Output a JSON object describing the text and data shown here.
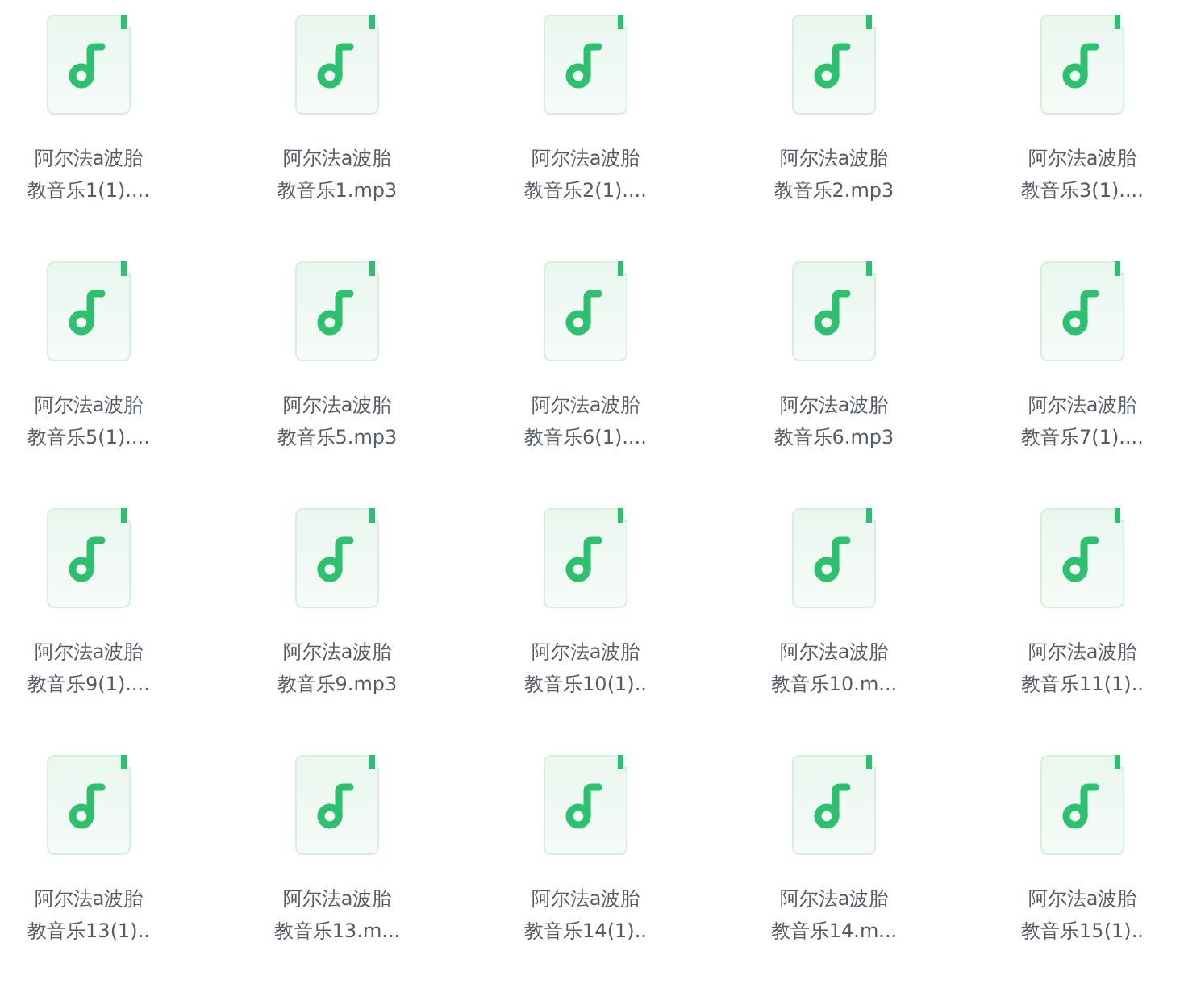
{
  "files": [
    {
      "lines": [
        "阿尔法a波胎",
        "教音乐1(1)...."
      ]
    },
    {
      "lines": [
        "阿尔法a波胎",
        "教音乐1.mp3"
      ]
    },
    {
      "lines": [
        "阿尔法a波胎",
        "教音乐2(1)...."
      ]
    },
    {
      "lines": [
        "阿尔法a波胎",
        "教音乐2.mp3"
      ]
    },
    {
      "lines": [
        "阿尔法a波胎",
        "教音乐3(1)...."
      ]
    },
    {
      "lines": [
        "阿尔法a波胎",
        "教音乐5(1)...."
      ]
    },
    {
      "lines": [
        "阿尔法a波胎",
        "教音乐5.mp3"
      ]
    },
    {
      "lines": [
        "阿尔法a波胎",
        "教音乐6(1)...."
      ]
    },
    {
      "lines": [
        "阿尔法a波胎",
        "教音乐6.mp3"
      ]
    },
    {
      "lines": [
        "阿尔法a波胎",
        "教音乐7(1)...."
      ]
    },
    {
      "lines": [
        "阿尔法a波胎",
        "教音乐9(1)...."
      ]
    },
    {
      "lines": [
        "阿尔法a波胎",
        "教音乐9.mp3"
      ]
    },
    {
      "lines": [
        "阿尔法a波胎",
        "教音乐10(1).."
      ]
    },
    {
      "lines": [
        "阿尔法a波胎",
        "教音乐10.m..."
      ]
    },
    {
      "lines": [
        "阿尔法a波胎",
        "教音乐11(1).."
      ]
    },
    {
      "lines": [
        "阿尔法a波胎",
        "教音乐13(1).."
      ]
    },
    {
      "lines": [
        "阿尔法a波胎",
        "教音乐13.m..."
      ]
    },
    {
      "lines": [
        "阿尔法a波胎",
        "教音乐14(1).."
      ]
    },
    {
      "lines": [
        "阿尔法a波胎",
        "教音乐14.m..."
      ]
    },
    {
      "lines": [
        "阿尔法a波胎",
        "教音乐15(1).."
      ]
    }
  ]
}
